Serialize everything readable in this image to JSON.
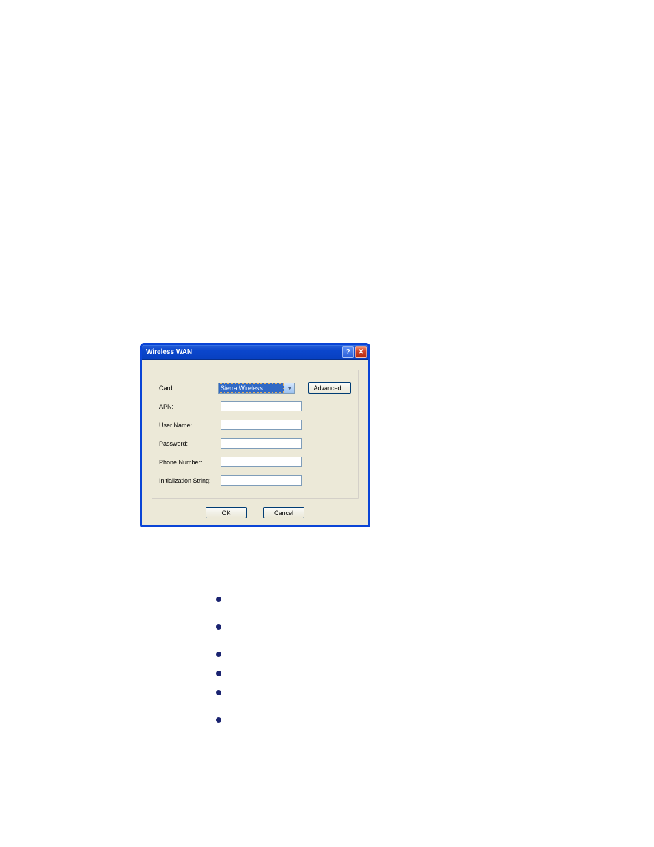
{
  "dialog": {
    "title": "Wireless WAN",
    "fields": {
      "card_label": "Card:",
      "card_value": "Sierra Wireless",
      "apn_label": "APN:",
      "apn_value": "",
      "username_label": "User Name:",
      "username_value": "",
      "password_label": "Password:",
      "password_value": "",
      "phone_label": "Phone Number:",
      "phone_value": "",
      "init_label": "Initialization String:",
      "init_value": ""
    },
    "buttons": {
      "advanced": "Advanced...",
      "ok": "OK",
      "cancel": "Cancel",
      "help": "?",
      "close": "✕"
    }
  }
}
